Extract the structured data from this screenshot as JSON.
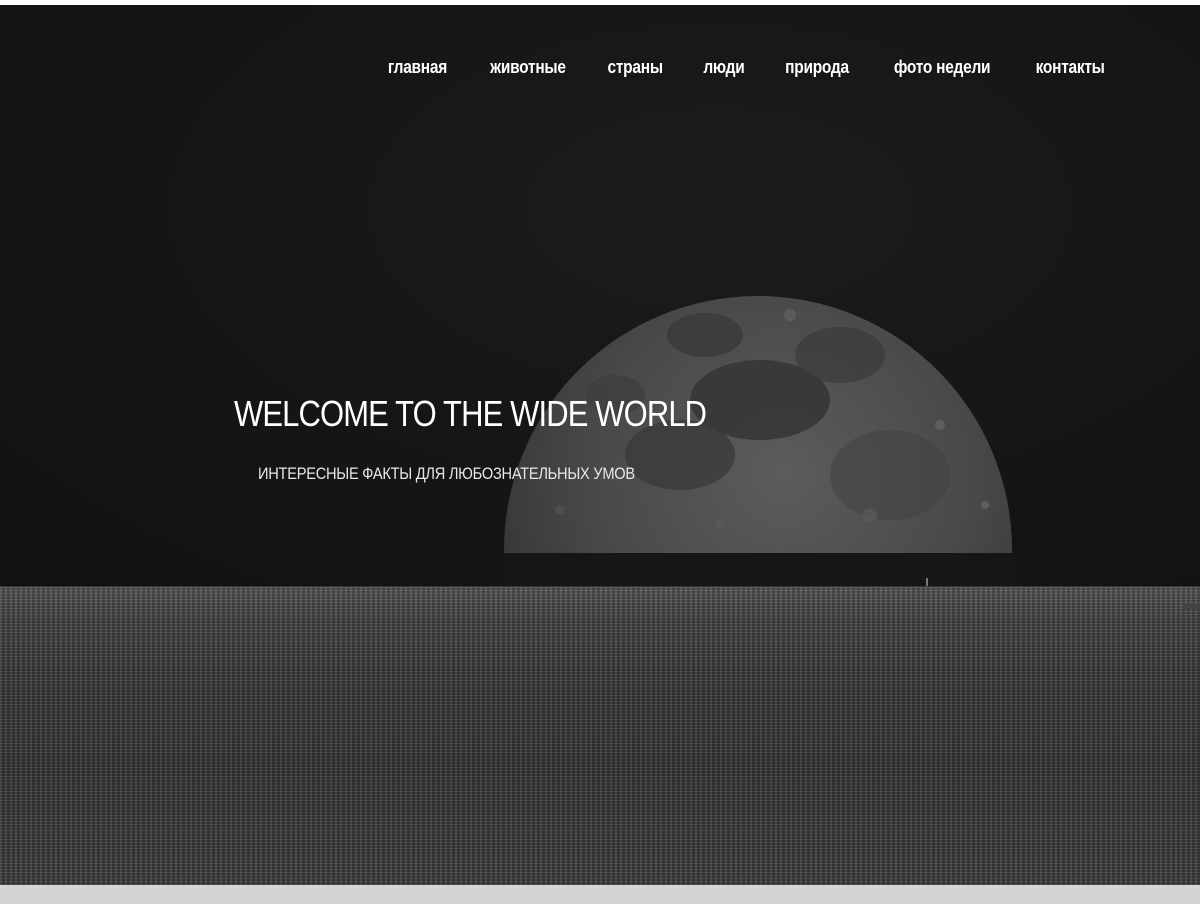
{
  "nav": {
    "items": [
      {
        "label": "главная"
      },
      {
        "label": "животные"
      },
      {
        "label": "страны"
      },
      {
        "label": "люди"
      },
      {
        "label": "природа"
      },
      {
        "label": "фото недели"
      },
      {
        "label": "контакты"
      }
    ]
  },
  "hero": {
    "title": "WELCOME TO THE WIDE WORLD",
    "subtitle": "ИНТЕРЕСНЫЕ ФАКТЫ ДЛЯ ЛЮБОЗНАТЕЛЬНЫХ УМОВ",
    "background": "moon-over-sea-image"
  },
  "colors": {
    "sky": "#141414",
    "sea": "#3d3d3d",
    "text": "#ffffff",
    "footer_bar": "#d4d4d4"
  }
}
